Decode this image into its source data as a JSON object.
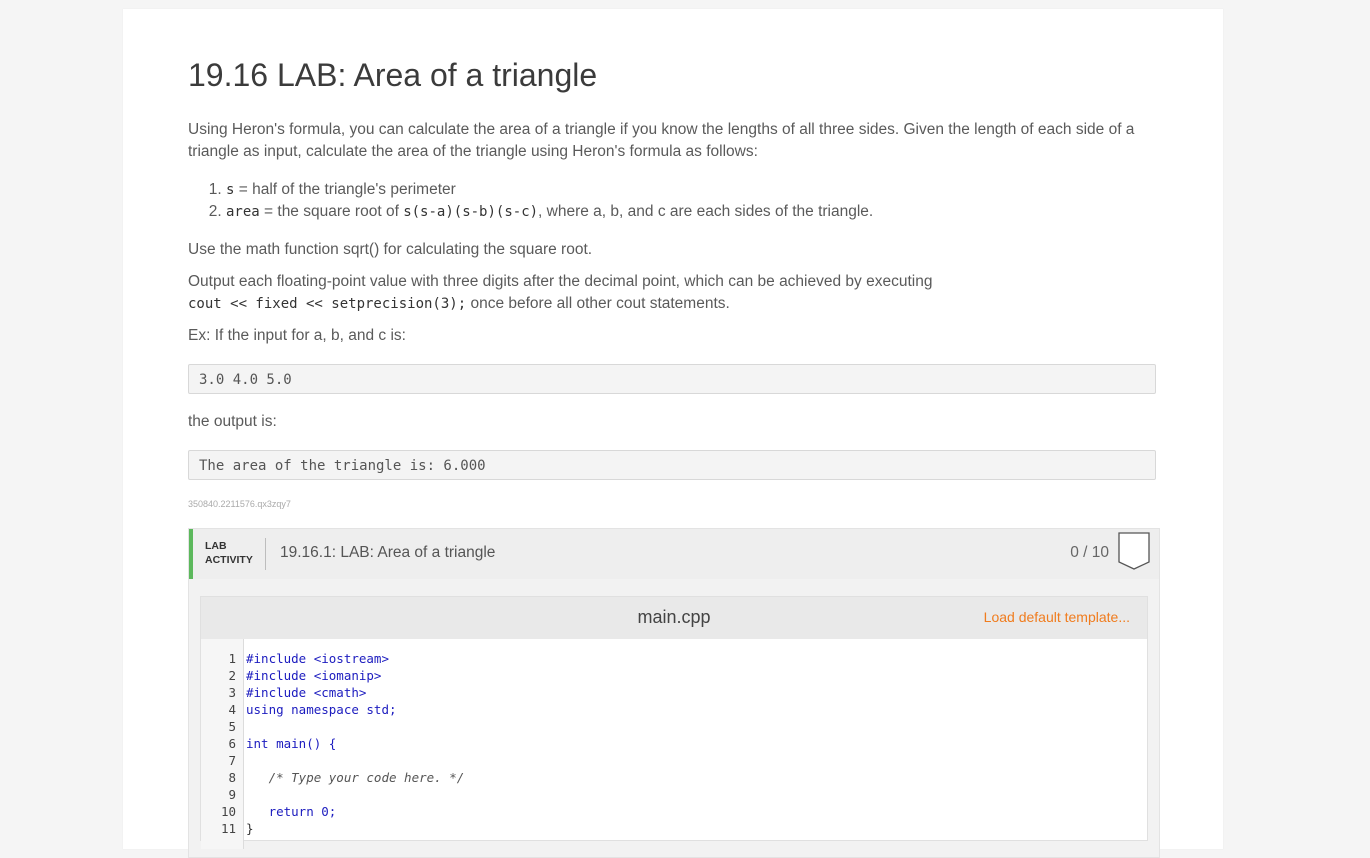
{
  "title": "19.16 LAB: Area of a triangle",
  "intro": "Using Heron's formula, you can calculate the area of a triangle if you know the lengths of all three sides. Given the length of each side of a triangle as input, calculate the area of the triangle using Heron's formula as follows:",
  "steps": [
    {
      "code": "s",
      "text": " = half of the triangle's perimeter"
    },
    {
      "code": "area",
      "text": " = the square root of ",
      "code2": "s(s-a)(s-b)(s-c)",
      "text2": ", where a, b, and c are each sides of the triangle."
    }
  ],
  "sqrt_note": "Use the math function sqrt() for calculating the square root.",
  "output_note": "Output each floating-point value with three digits after the decimal point, which can be achieved by executing",
  "output_code": "cout << fixed << setprecision(3);",
  "output_note2": " once before all other cout statements.",
  "example_intro": "Ex: If the input for a, b, and c is:",
  "example_input": "3.0 4.0 5.0",
  "output_intro": "the output is:",
  "example_output": "The area of the triangle is: 6.000",
  "identifier": "350840.2211576.qx3zqy7",
  "lab": {
    "tag_line1": "LAB",
    "tag_line2": "ACTIVITY",
    "title": "19.16.1: LAB: Area of a triangle",
    "score": "0 / 10",
    "accent_color": "#5cb85c"
  },
  "editor": {
    "filename": "main.cpp",
    "load_template": "Load default template...",
    "lines": [
      {
        "n": "1",
        "code": "#include <iostream>"
      },
      {
        "n": "2",
        "code": "#include <iomanip>"
      },
      {
        "n": "3",
        "code": "#include <cmath>"
      },
      {
        "n": "4",
        "code": "using namespace std;"
      },
      {
        "n": "5",
        "code": ""
      },
      {
        "n": "6",
        "code": "int main() {"
      },
      {
        "n": "7",
        "code": ""
      },
      {
        "n": "8",
        "code": "   /* Type your code here. */"
      },
      {
        "n": "9",
        "code": ""
      },
      {
        "n": "10",
        "code": "   return 0;"
      },
      {
        "n": "11",
        "code": "}"
      }
    ]
  }
}
